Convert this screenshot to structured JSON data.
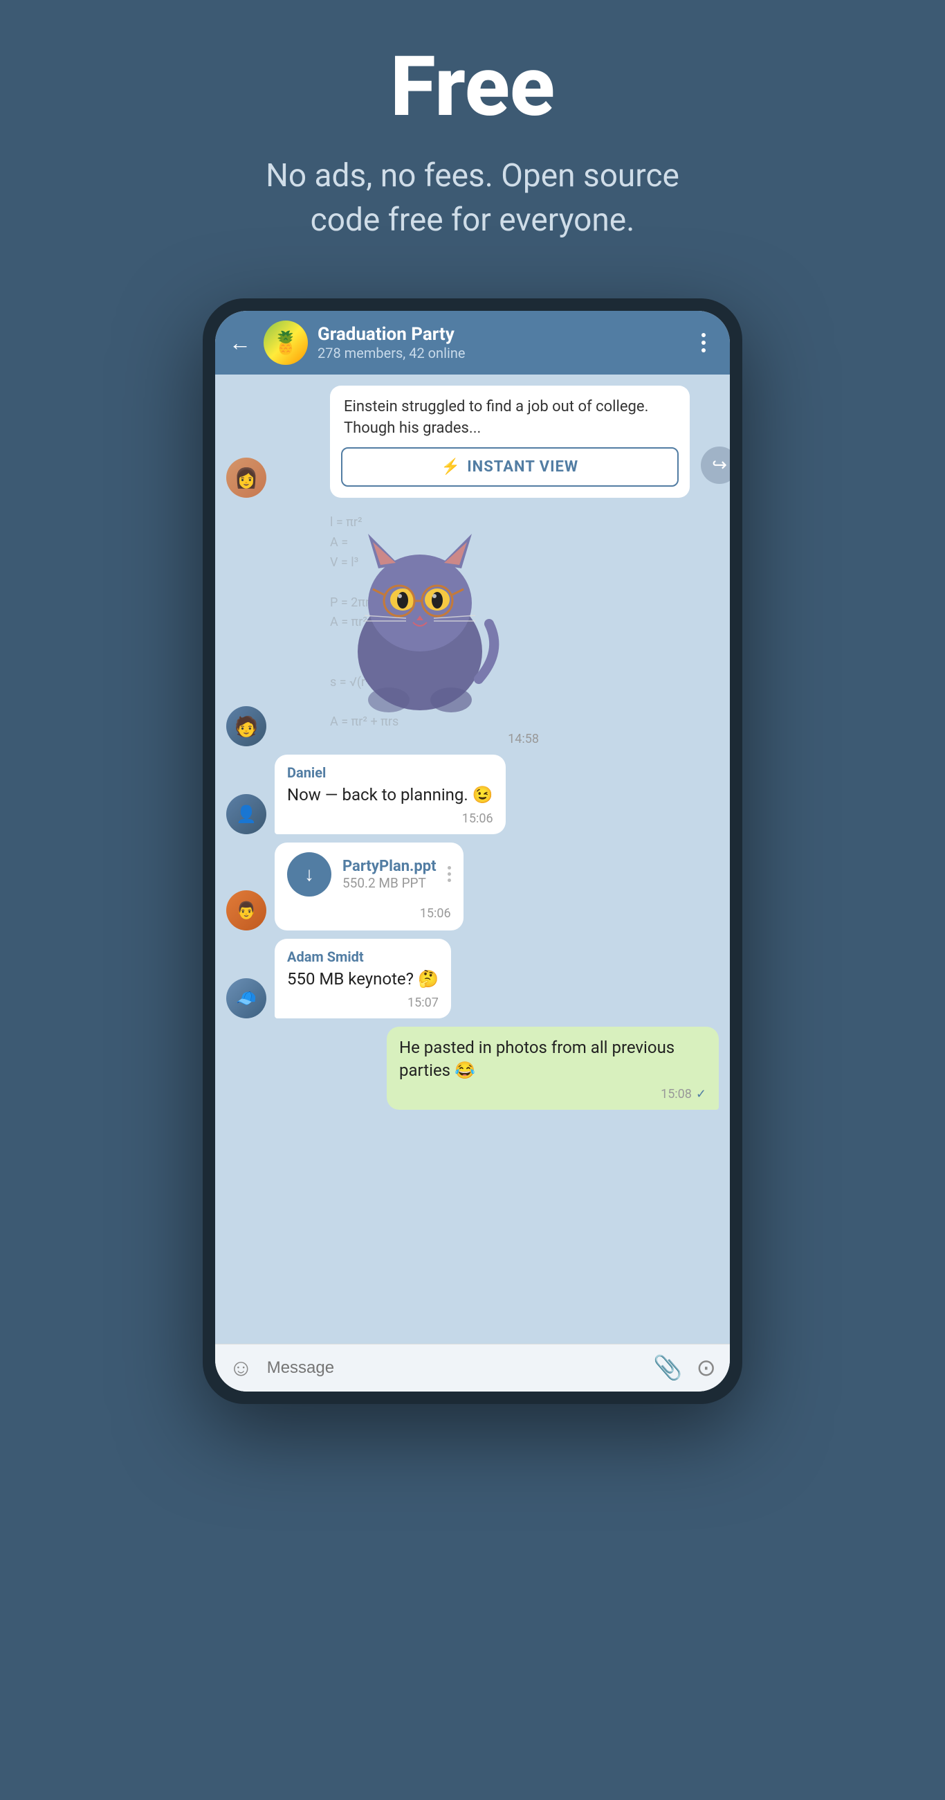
{
  "hero": {
    "title": "Free",
    "subtitle": "No ads, no fees. Open source code free for everyone."
  },
  "chat": {
    "back_label": "←",
    "group_name": "Graduation Party",
    "group_members": "278 members, 42 online",
    "more_label": "⋮"
  },
  "article": {
    "text": "Einstein struggled to find a job out of college. Though his grades...",
    "instant_view_label": "INSTANT VIEW"
  },
  "messages": [
    {
      "id": "sticker",
      "time": "14:58"
    },
    {
      "id": "daniel-msg",
      "sender": "Daniel",
      "text": "Now — back to planning. 😉",
      "time": "15:06"
    },
    {
      "id": "file-msg",
      "file_name": "PartyPlan.ppt",
      "file_size": "550.2 MB PPT",
      "time": "15:06"
    },
    {
      "id": "adam-msg",
      "sender": "Adam Smidt",
      "text": "550 MB keynote? 🤔",
      "time": "15:07"
    },
    {
      "id": "self-msg",
      "text": "He pasted in photos from all previous parties 😂",
      "time": "15:08",
      "check": true
    }
  ],
  "bottom_bar": {
    "placeholder": "Message"
  },
  "math_formulas": [
    "l = πr²",
    "A =",
    "V = l³",
    "P = 2πr",
    "A = πr²",
    "s = √(r²+h²)",
    "A = πr² + πrs"
  ]
}
